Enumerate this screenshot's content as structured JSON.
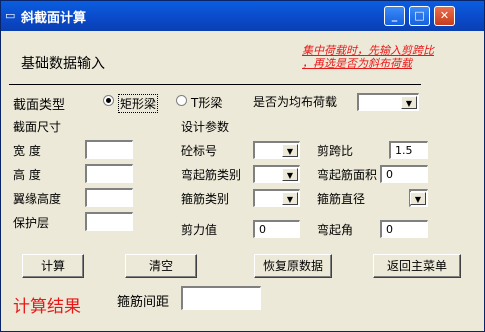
{
  "window": {
    "title": "斜截面计算"
  },
  "header": {
    "section_title": "基础数据输入",
    "note_line1": "集中荷载时，先输入剪跨比",
    "note_line2": "，再选是否为斜布荷载"
  },
  "section": {
    "label": "截面类型",
    "radio_rect_label": "矩形梁",
    "radio_t_label": "T形梁",
    "uniform_load_label": "是否为均布荷载",
    "size_label": "截面尺寸",
    "design_params_label": "设计参数"
  },
  "fields": {
    "width_label": "宽    度",
    "height_label": "高    度",
    "flange_height_label": "翼缘高度",
    "cover_label": "保护层",
    "concrete_label": "砼标号",
    "bent_bar_type_label": "弯起筋类别",
    "stirrup_type_label": "箍筋类别",
    "shear_label": "剪力值",
    "shear_value": "0",
    "shear_span_label": "剪跨比",
    "shear_span_value": "1.5",
    "bent_area_label": "弯起筋面积",
    "bent_area_value": "0",
    "stirrup_dia_label": "箍筋直径",
    "bent_angle_label": "弯起角",
    "bent_angle_value": "0"
  },
  "buttons": {
    "calc": "计算",
    "clear": "清空",
    "restore": "恢复原数据",
    "back": "返回主菜单"
  },
  "result": {
    "title": "计算结果",
    "stirrup_spacing_label": "箍筋间距",
    "stirrup_spacing_value": ""
  },
  "colors": {
    "accent_red": "#e81818",
    "title_bar": "#0a49c8"
  }
}
